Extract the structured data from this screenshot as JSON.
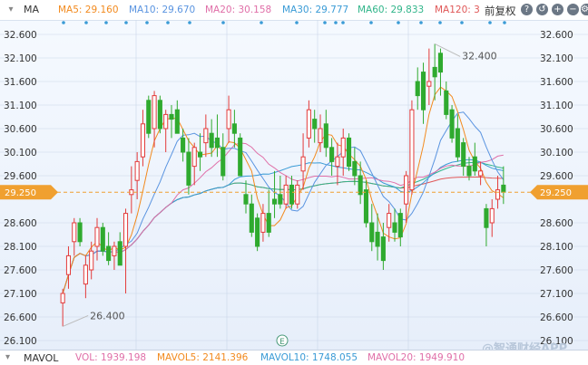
{
  "ma_bar": {
    "toggle": "▾",
    "name": "MA",
    "items": [
      {
        "text": "MA5: 29.160",
        "color": "#f28a1e"
      },
      {
        "text": "MA10: 29.670",
        "color": "#5a94e0"
      },
      {
        "text": "MA20: 30.158",
        "color": "#e06fa8"
      },
      {
        "text": "MA30: 29.777",
        "color": "#3a9bd6"
      },
      {
        "text": "MA60: 29.833",
        "color": "#31b58a"
      },
      {
        "text": "MA120: 3",
        "color": "#e05757"
      }
    ],
    "adjust": "前复权"
  },
  "toolbar": {
    "help_icon": "?",
    "reset_icon": "↺",
    "zoom_in_icon": "+",
    "zoom_out_icon": "−",
    "settings_icon": "⚙"
  },
  "vol_bar": {
    "toggle": "▾",
    "name": "MAVOL",
    "items": [
      {
        "text": "VOL: 1939.198",
        "color": "#e06fa8"
      },
      {
        "text": "MAVOL5: 2141.396",
        "color": "#f28a1e"
      },
      {
        "text": "MAVOL10: 1748.055",
        "color": "#3a9bd6"
      },
      {
        "text": "MAVOL20: 1949.910",
        "color": "#e06fa8"
      }
    ]
  },
  "watermark": "@智通财经APP",
  "event_marker": "E",
  "annotations": {
    "high": "32.400",
    "low": "26.400"
  },
  "current_price": "29.250",
  "chart_data": {
    "type": "candlestick",
    "y_ticks": [
      "32.600",
      "32.100",
      "31.600",
      "31.100",
      "30.600",
      "30.100",
      "29.600",
      "28.600",
      "28.100",
      "27.600",
      "27.100",
      "26.600",
      "26.100"
    ],
    "ylim": [
      26.1,
      32.6
    ],
    "grid": true,
    "colors": {
      "up": "#e33a3a",
      "down": "#2faa2f",
      "ma5": "#f28a1e",
      "ma10": "#5a94e0",
      "ma20": "#e06fa8",
      "ma30": "#3a9bd6",
      "ma60": "#31b58a",
      "ma120": "#e05757",
      "price_line": "#f0a030",
      "grid": "#c9d6e8"
    },
    "candles": [
      {
        "o": 26.9,
        "h": 27.2,
        "l": 26.4,
        "c": 27.1
      },
      {
        "o": 27.5,
        "h": 28.1,
        "l": 27.2,
        "c": 27.9
      },
      {
        "o": 28.2,
        "h": 28.7,
        "l": 27.9,
        "c": 28.6
      },
      {
        "o": 28.6,
        "h": 28.7,
        "l": 28.1,
        "c": 28.2
      },
      {
        "o": 27.3,
        "h": 27.9,
        "l": 27.0,
        "c": 27.7
      },
      {
        "o": 27.6,
        "h": 28.2,
        "l": 27.4,
        "c": 28.0
      },
      {
        "o": 28.1,
        "h": 28.7,
        "l": 27.8,
        "c": 28.5
      },
      {
        "o": 28.5,
        "h": 28.6,
        "l": 27.9,
        "c": 28.0
      },
      {
        "o": 28.1,
        "h": 28.4,
        "l": 27.7,
        "c": 27.8
      },
      {
        "o": 27.9,
        "h": 28.2,
        "l": 27.6,
        "c": 28.1
      },
      {
        "o": 28.2,
        "h": 28.4,
        "l": 27.7,
        "c": 27.7
      },
      {
        "o": 28.1,
        "h": 28.9,
        "l": 27.1,
        "c": 28.8
      },
      {
        "o": 29.2,
        "h": 29.8,
        "l": 28.8,
        "c": 29.3
      },
      {
        "o": 29.5,
        "h": 30.1,
        "l": 29.1,
        "c": 29.9
      },
      {
        "o": 30.0,
        "h": 31.0,
        "l": 29.8,
        "c": 30.7
      },
      {
        "o": 31.2,
        "h": 31.3,
        "l": 30.4,
        "c": 30.5
      },
      {
        "o": 30.6,
        "h": 31.4,
        "l": 30.2,
        "c": 31.3
      },
      {
        "o": 31.2,
        "h": 31.3,
        "l": 30.5,
        "c": 30.6
      },
      {
        "o": 30.6,
        "h": 31.0,
        "l": 30.1,
        "c": 30.9
      },
      {
        "o": 30.9,
        "h": 31.1,
        "l": 30.4,
        "c": 30.8
      },
      {
        "o": 31.0,
        "h": 31.2,
        "l": 30.5,
        "c": 30.5
      },
      {
        "o": 30.4,
        "h": 30.6,
        "l": 29.9,
        "c": 30.1
      },
      {
        "o": 30.1,
        "h": 30.4,
        "l": 29.2,
        "c": 29.4
      },
      {
        "o": 29.8,
        "h": 30.3,
        "l": 29.4,
        "c": 30.2
      },
      {
        "o": 30.1,
        "h": 30.5,
        "l": 29.7,
        "c": 30.0
      },
      {
        "o": 30.3,
        "h": 30.9,
        "l": 30.0,
        "c": 30.6
      },
      {
        "o": 30.5,
        "h": 30.8,
        "l": 30.0,
        "c": 30.2
      },
      {
        "o": 30.4,
        "h": 30.9,
        "l": 30.0,
        "c": 30.2
      },
      {
        "o": 30.2,
        "h": 30.5,
        "l": 29.5,
        "c": 29.6
      },
      {
        "o": 30.6,
        "h": 31.3,
        "l": 30.3,
        "c": 31.0
      },
      {
        "o": 30.7,
        "h": 31.0,
        "l": 30.2,
        "c": 30.5
      },
      {
        "o": 30.4,
        "h": 30.5,
        "l": 29.6,
        "c": 29.6
      },
      {
        "o": 29.2,
        "h": 29.5,
        "l": 28.8,
        "c": 29.0
      },
      {
        "o": 29.0,
        "h": 29.2,
        "l": 28.3,
        "c": 28.4
      },
      {
        "o": 28.7,
        "h": 28.8,
        "l": 28.0,
        "c": 28.1
      },
      {
        "o": 28.4,
        "h": 29.0,
        "l": 28.2,
        "c": 28.8
      },
      {
        "o": 28.8,
        "h": 29.3,
        "l": 28.3,
        "c": 28.4
      },
      {
        "o": 29.1,
        "h": 29.7,
        "l": 28.7,
        "c": 29.0
      },
      {
        "o": 29.2,
        "h": 29.6,
        "l": 28.9,
        "c": 29.0
      },
      {
        "o": 29.0,
        "h": 29.6,
        "l": 28.9,
        "c": 29.4
      },
      {
        "o": 29.4,
        "h": 29.6,
        "l": 28.9,
        "c": 29.0
      },
      {
        "o": 29.0,
        "h": 29.5,
        "l": 28.9,
        "c": 29.4
      },
      {
        "o": 29.7,
        "h": 30.5,
        "l": 29.3,
        "c": 30.0
      },
      {
        "o": 30.4,
        "h": 31.2,
        "l": 30.2,
        "c": 31.0
      },
      {
        "o": 30.8,
        "h": 31.0,
        "l": 30.3,
        "c": 30.6
      },
      {
        "o": 30.3,
        "h": 30.9,
        "l": 30.1,
        "c": 30.6
      },
      {
        "o": 30.7,
        "h": 31.0,
        "l": 30.0,
        "c": 30.2
      },
      {
        "o": 30.2,
        "h": 30.4,
        "l": 29.6,
        "c": 29.9
      },
      {
        "o": 29.8,
        "h": 30.3,
        "l": 29.4,
        "c": 30.0
      },
      {
        "o": 30.0,
        "h": 30.6,
        "l": 29.6,
        "c": 30.4
      },
      {
        "o": 30.4,
        "h": 30.5,
        "l": 29.7,
        "c": 29.8
      },
      {
        "o": 29.9,
        "h": 30.2,
        "l": 29.4,
        "c": 29.6
      },
      {
        "o": 29.6,
        "h": 29.9,
        "l": 29.0,
        "c": 29.2
      },
      {
        "o": 29.3,
        "h": 29.5,
        "l": 28.5,
        "c": 28.6
      },
      {
        "o": 28.6,
        "h": 29.0,
        "l": 28.0,
        "c": 28.2
      },
      {
        "o": 28.4,
        "h": 28.8,
        "l": 27.8,
        "c": 28.1
      },
      {
        "o": 28.3,
        "h": 28.6,
        "l": 27.6,
        "c": 27.8
      },
      {
        "o": 28.5,
        "h": 29.0,
        "l": 28.2,
        "c": 28.8
      },
      {
        "o": 28.6,
        "h": 28.9,
        "l": 28.2,
        "c": 28.4
      },
      {
        "o": 28.8,
        "h": 28.9,
        "l": 28.1,
        "c": 28.3
      },
      {
        "o": 29.0,
        "h": 29.7,
        "l": 28.6,
        "c": 29.6
      },
      {
        "o": 29.3,
        "h": 31.2,
        "l": 29.2,
        "c": 31.0
      },
      {
        "o": 31.6,
        "h": 31.9,
        "l": 31.0,
        "c": 31.3
      },
      {
        "o": 31.8,
        "h": 32.0,
        "l": 30.7,
        "c": 31.0
      },
      {
        "o": 31.5,
        "h": 32.3,
        "l": 31.1,
        "c": 31.6
      },
      {
        "o": 31.9,
        "h": 32.4,
        "l": 31.2,
        "c": 31.7
      },
      {
        "o": 32.2,
        "h": 32.3,
        "l": 31.3,
        "c": 31.8
      },
      {
        "o": 31.4,
        "h": 31.6,
        "l": 30.8,
        "c": 30.9
      },
      {
        "o": 31.0,
        "h": 31.1,
        "l": 30.3,
        "c": 30.4
      },
      {
        "o": 30.6,
        "h": 30.9,
        "l": 29.9,
        "c": 30.0
      },
      {
        "o": 30.3,
        "h": 30.4,
        "l": 29.6,
        "c": 29.8
      },
      {
        "o": 29.8,
        "h": 30.0,
        "l": 29.5,
        "c": 29.6
      },
      {
        "o": 30.0,
        "h": 30.3,
        "l": 29.6,
        "c": 29.7
      },
      {
        "o": 29.6,
        "h": 29.9,
        "l": 29.4,
        "c": 29.7
      },
      {
        "o": 28.9,
        "h": 29.0,
        "l": 28.1,
        "c": 28.5
      },
      {
        "o": 28.6,
        "h": 29.1,
        "l": 28.3,
        "c": 28.9
      },
      {
        "o": 29.1,
        "h": 29.6,
        "l": 28.9,
        "c": 29.3
      },
      {
        "o": 29.4,
        "h": 29.8,
        "l": 29.0,
        "c": 29.25
      }
    ]
  }
}
